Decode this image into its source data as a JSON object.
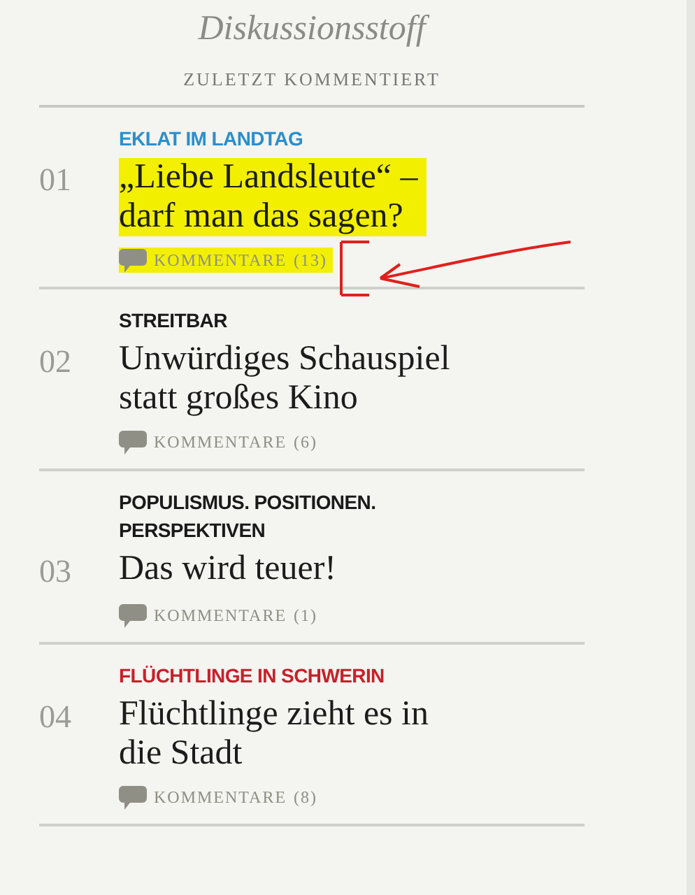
{
  "header": {
    "title": "Diskussionsstoff",
    "subtitle": "ZULETZT KOMMENTIERT"
  },
  "items": [
    {
      "number": "01",
      "kicker": "EKLAT IM LANDTAG",
      "color": "#2a8fce",
      "title_lines": [
        "„Liebe Landsleute“ –",
        "darf man das sagen?"
      ],
      "comments": "KOMMENTARE",
      "count": "(13)",
      "highlighted": true,
      "annotated": true
    },
    {
      "number": "02",
      "kicker": "STREITBAR",
      "color": "#1a1a1a",
      "title_lines": [
        "Unwürdiges Schauspiel",
        "statt großes Kino"
      ],
      "comments": "KOMMENTARE",
      "count": "(6)",
      "highlighted": false,
      "annotated": false
    },
    {
      "number": "03",
      "kicker": "POPULISMUS. POSITIONEN. PERSPEKTIVEN",
      "color": "#1a1a1a",
      "title_lines": [
        "Das wird teuer!"
      ],
      "comments": "KOMMENTARE",
      "count": "(1)",
      "highlighted": false,
      "annotated": false
    },
    {
      "number": "04",
      "kicker": "FLÜCHTLINGE IN SCHWERIN",
      "color": "#c8202a",
      "title_lines": [
        "Flüchtlinge zieht es in",
        "die Stadt"
      ],
      "comments": "KOMMENTARE",
      "count": "(8)",
      "highlighted": false,
      "annotated": false
    }
  ]
}
